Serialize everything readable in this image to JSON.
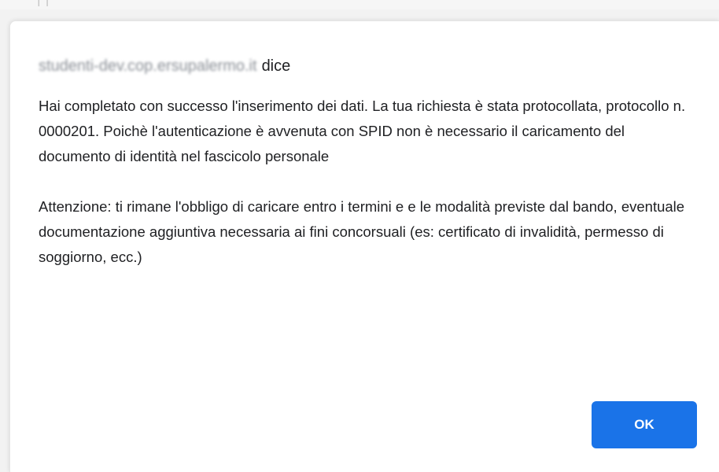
{
  "browser_fragment": "| |",
  "dialog": {
    "origin": "studenti-dev.cop.ersupalermo.it",
    "origin_suffix": "dice",
    "message_paragraph_1": "Hai completato con successo l'inserimento dei dati. La tua richiesta è stata protocollata, protocollo n. 0000201. Poichè l'autenticazione è avvenuta con SPID non è necessario il caricamento del documento di identità nel fascicolo personale",
    "message_paragraph_2": "Attenzione: ti rimane l'obbligo di caricare entro i termini e e le modalità previste dal bando, eventuale documentazione aggiuntiva necessaria ai fini concorsuali (es: certificato di invalidità, permesso di soggiorno, ecc.)",
    "ok_label": "OK",
    "accent_color": "#1a73e8"
  }
}
